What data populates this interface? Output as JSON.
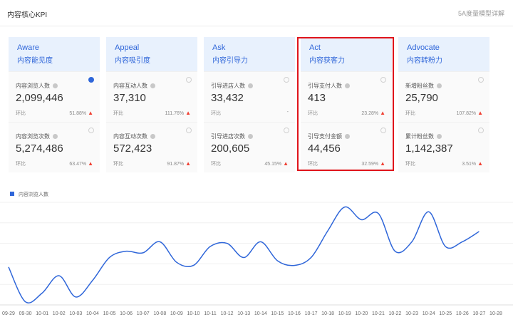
{
  "header": {
    "title": "内容核心KPI",
    "detail_link": "5A度量模型详解"
  },
  "columns": [
    {
      "en": "Aware",
      "cn": "内容能见度",
      "cards": [
        {
          "label": "内容浏览人数",
          "value": "2,099,446",
          "compare": "环比",
          "pct": "51.88%",
          "selected": true
        },
        {
          "label": "内容浏览次数",
          "value": "5,274,486",
          "compare": "环比",
          "pct": "63.47%",
          "selected": false
        }
      ]
    },
    {
      "en": "Appeal",
      "cn": "内容吸引度",
      "cards": [
        {
          "label": "内容互动人数",
          "value": "37,310",
          "compare": "环比",
          "pct": "111.76%",
          "selected": false
        },
        {
          "label": "内容互动次数",
          "value": "572,423",
          "compare": "环比",
          "pct": "91.87%",
          "selected": false
        }
      ]
    },
    {
      "en": "Ask",
      "cn": "内容引导力",
      "cards": [
        {
          "label": "引导进店人数",
          "value": "33,432",
          "compare": "环比",
          "pct": "-",
          "selected": false
        },
        {
          "label": "引导进店次数",
          "value": "200,605",
          "compare": "环比",
          "pct": "45.15%",
          "selected": false
        }
      ]
    },
    {
      "en": "Act",
      "cn": "内容获客力",
      "cards": [
        {
          "label": "引导支付人数",
          "value": "413",
          "compare": "环比",
          "pct": "23.28%",
          "selected": false
        },
        {
          "label": "引导支付金额",
          "value": "44,456",
          "compare": "环比",
          "pct": "32.59%",
          "selected": false
        }
      ]
    },
    {
      "en": "Advocate",
      "cn": "内容转粉力",
      "cards": [
        {
          "label": "新增粉丝数",
          "value": "25,790",
          "compare": "环比",
          "pct": "107.82%",
          "selected": false
        },
        {
          "label": "累计粉丝数",
          "value": "1,142,387",
          "compare": "环比",
          "pct": "3.51%",
          "selected": false
        }
      ]
    }
  ],
  "colors": {
    "accent": "#2f66d9",
    "up_arrow": "#f04134",
    "highlight_border": "#e0141b"
  },
  "chart_data": {
    "type": "line",
    "series": [
      {
        "name": "内容浏览人数",
        "values": [
          48,
          4,
          15,
          37,
          10,
          31,
          60,
          68,
          66,
          80,
          54,
          50,
          74,
          78,
          60,
          80,
          56,
          50,
          60,
          94,
          124,
          108,
          116,
          68,
          80,
          118,
          74,
          80,
          93
        ]
      }
    ],
    "x": [
      "09-29",
      "09-30",
      "10-01",
      "10-02",
      "10-03",
      "10-04",
      "10-05",
      "10-06",
      "10-07",
      "10-08",
      "10-09",
      "10-10",
      "10-11",
      "10-12",
      "10-13",
      "10-14",
      "10-15",
      "10-16",
      "10-17",
      "10-18",
      "10-19",
      "10-20",
      "10-21",
      "10-22",
      "10-23",
      "10-24",
      "10-25",
      "10-26",
      "10-27",
      "10-28"
    ],
    "ylim": [
      0,
      130
    ],
    "grid": true,
    "legend": "top-left"
  }
}
